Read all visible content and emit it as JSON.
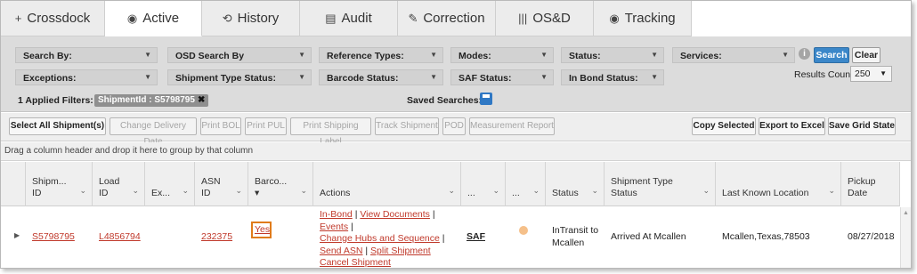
{
  "tabs": [
    {
      "label": "Crossdock",
      "icon": "+"
    },
    {
      "label": "Active",
      "icon": "◉"
    },
    {
      "label": "History",
      "icon": "⟲"
    },
    {
      "label": "Audit",
      "icon": "▤"
    },
    {
      "label": "Correction",
      "icon": "✎"
    },
    {
      "label": "OS&D",
      "icon": "|||"
    },
    {
      "label": "Tracking",
      "icon": "◉"
    }
  ],
  "filters": {
    "row1": [
      "Search By:",
      "OSD Search By",
      "Reference Types:",
      "Modes:",
      "Status:",
      "Services:"
    ],
    "row2": [
      "Exceptions:",
      "Shipment Type Status:",
      "Barcode Status:",
      "SAF Status:",
      "In Bond Status:"
    ],
    "search_label": "Search",
    "clear_label": "Clear",
    "results_count_label": "Results Count:",
    "results_count_value": "250",
    "applied_filters_label": "1 Applied Filters:",
    "applied_chip": "ShipmentId : S5798795",
    "chip_remove": "✖",
    "saved_searches_label": "Saved Searches:",
    "info_icon": "i"
  },
  "toolbar": {
    "left": [
      "Select All Shipment(s)",
      "Change Delivery Date",
      "Print BOL",
      "Print PUL",
      "Print Shipping Label",
      "Track Shipment",
      "POD",
      "Measurement Report"
    ],
    "right": [
      "Copy Selected",
      "Export to Excel",
      "Save Grid State"
    ]
  },
  "group_hint": "Drag a column header and drop it here to group by that column",
  "columns": [
    "Shipm... ID",
    "Load ID",
    "Ex...",
    "ASN ID",
    "Barco... ▾",
    "Actions",
    "...",
    "...",
    "Status",
    "Shipment Type Status",
    "Last Known Location",
    "Pickup Date"
  ],
  "row": {
    "shipment_id": "S5798795",
    "load_id": "L4856794",
    "asn_id": "232375",
    "barcode": "Yes",
    "actions_line1": [
      "In-Bond",
      "View Documents",
      "Events"
    ],
    "actions_line2": [
      "Change Hubs and Sequence"
    ],
    "actions_line3": [
      "Send ASN",
      "Split Shipment"
    ],
    "actions_line4": [
      "Cancel Shipment"
    ],
    "saf": "SAF",
    "status": "InTransit to Mcallen",
    "shipment_type_status": "Arrived At Mcallen",
    "last_known_location": "Mcallen,Texas,78503",
    "pickup_date": "08/27/2018"
  },
  "colors": {
    "accent": "#3b87c9",
    "link": "#c0392b",
    "highlight": "#e07b1a"
  }
}
